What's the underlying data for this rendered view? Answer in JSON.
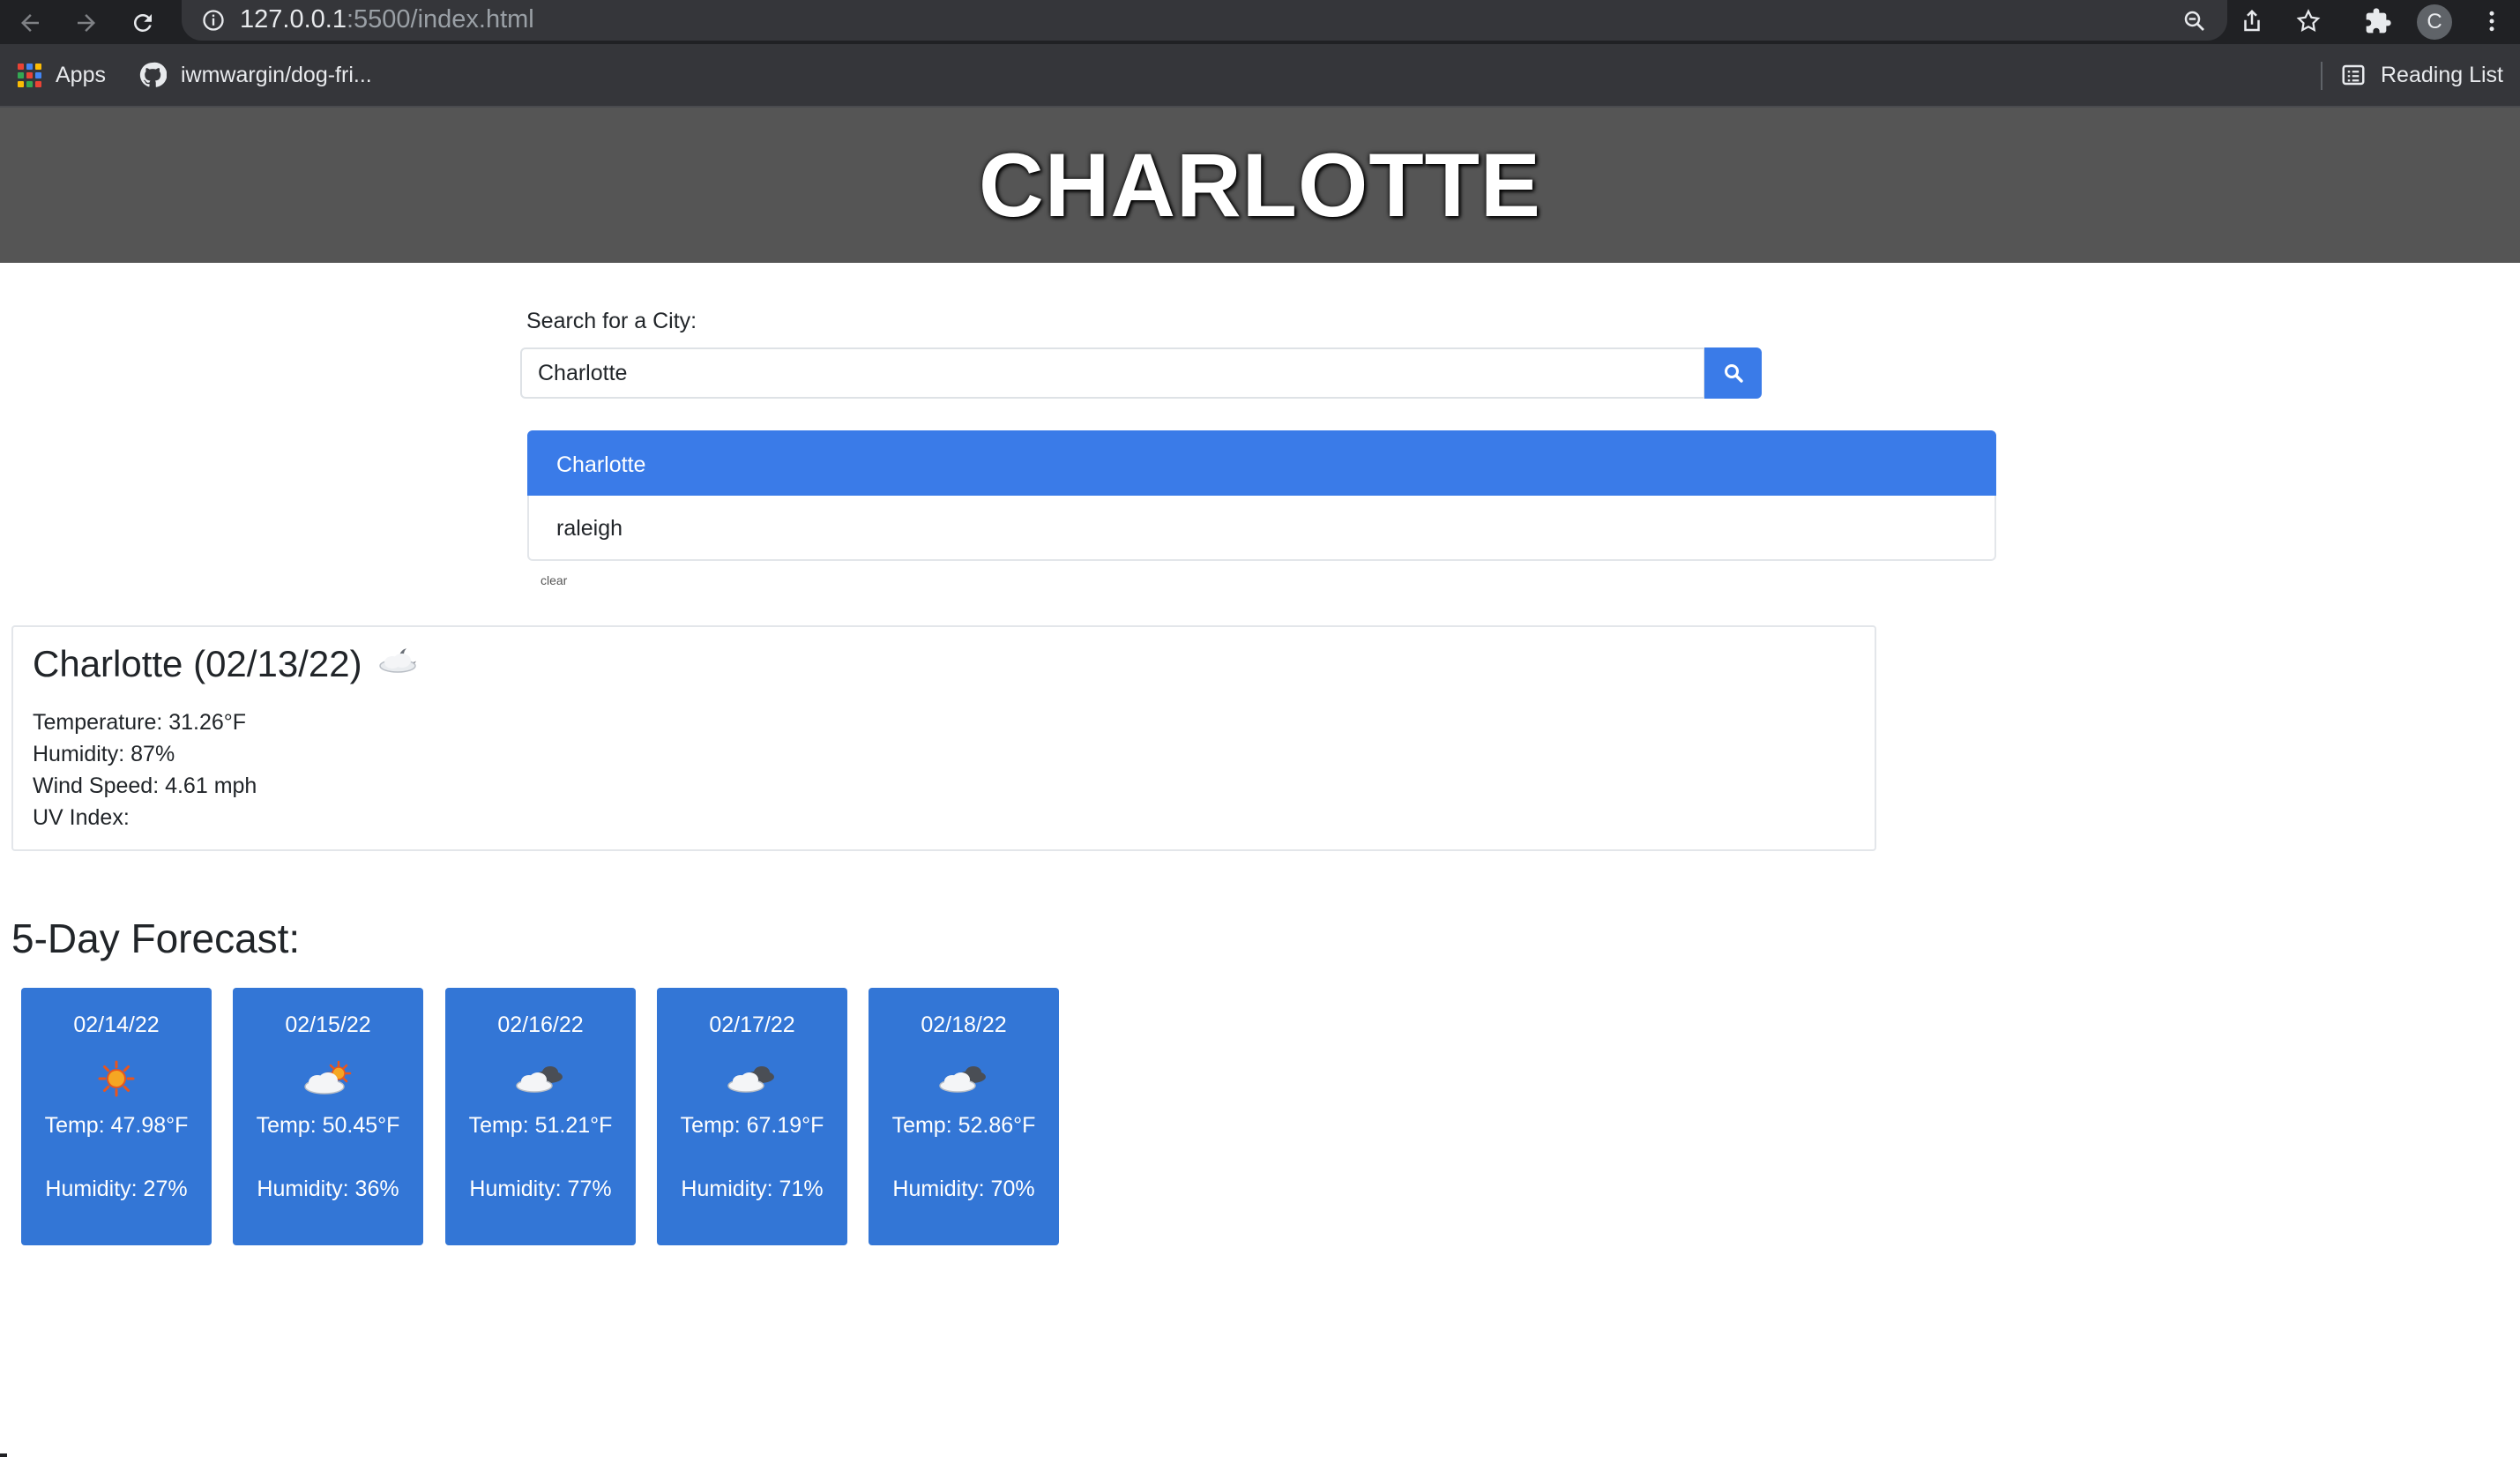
{
  "browser": {
    "url_host": "127.0.0.1",
    "url_rest": ":5500/index.html",
    "profile_initial": "C",
    "bookmarks": [
      {
        "label": "Apps",
        "icon": "apps-grid-icon"
      },
      {
        "label": "iwmwargin/dog-fri...",
        "icon": "github-icon"
      }
    ],
    "reading_list_label": "Reading List"
  },
  "header": {
    "title": "CHARLOTTE"
  },
  "search": {
    "label": "Search for a City:",
    "value": "Charlotte",
    "button_icon": "search-icon"
  },
  "history": {
    "items": [
      "Charlotte",
      "raleigh"
    ],
    "active_index": 0,
    "clear_label": "clear"
  },
  "current": {
    "title": "Charlotte (02/13/22)",
    "icon": "few-clouds-night-icon",
    "temperature": "Temperature: 31.26°F",
    "humidity": "Humidity: 87%",
    "wind": "Wind Speed: 4.61 mph",
    "uv": "UV Index:"
  },
  "forecast": {
    "title": "5-Day Forecast:",
    "days": [
      {
        "date": "02/14/22",
        "icon": "clear-sun-icon",
        "temp": "Temp: 47.98°F",
        "humidity": "Humidity: 27%"
      },
      {
        "date": "02/15/22",
        "icon": "few-clouds-day-icon",
        "temp": "Temp: 50.45°F",
        "humidity": "Humidity: 36%"
      },
      {
        "date": "02/16/22",
        "icon": "broken-clouds-icon",
        "temp": "Temp: 51.21°F",
        "humidity": "Humidity: 77%"
      },
      {
        "date": "02/17/22",
        "icon": "broken-clouds-icon",
        "temp": "Temp: 67.19°F",
        "humidity": "Humidity: 71%"
      },
      {
        "date": "02/18/22",
        "icon": "broken-clouds-icon",
        "temp": "Temp: 52.86°F",
        "humidity": "Humidity: 70%"
      }
    ]
  },
  "colors": {
    "header_bg": "#555555",
    "accent_blue": "#3a7be8",
    "card_blue": "#3376d6"
  }
}
